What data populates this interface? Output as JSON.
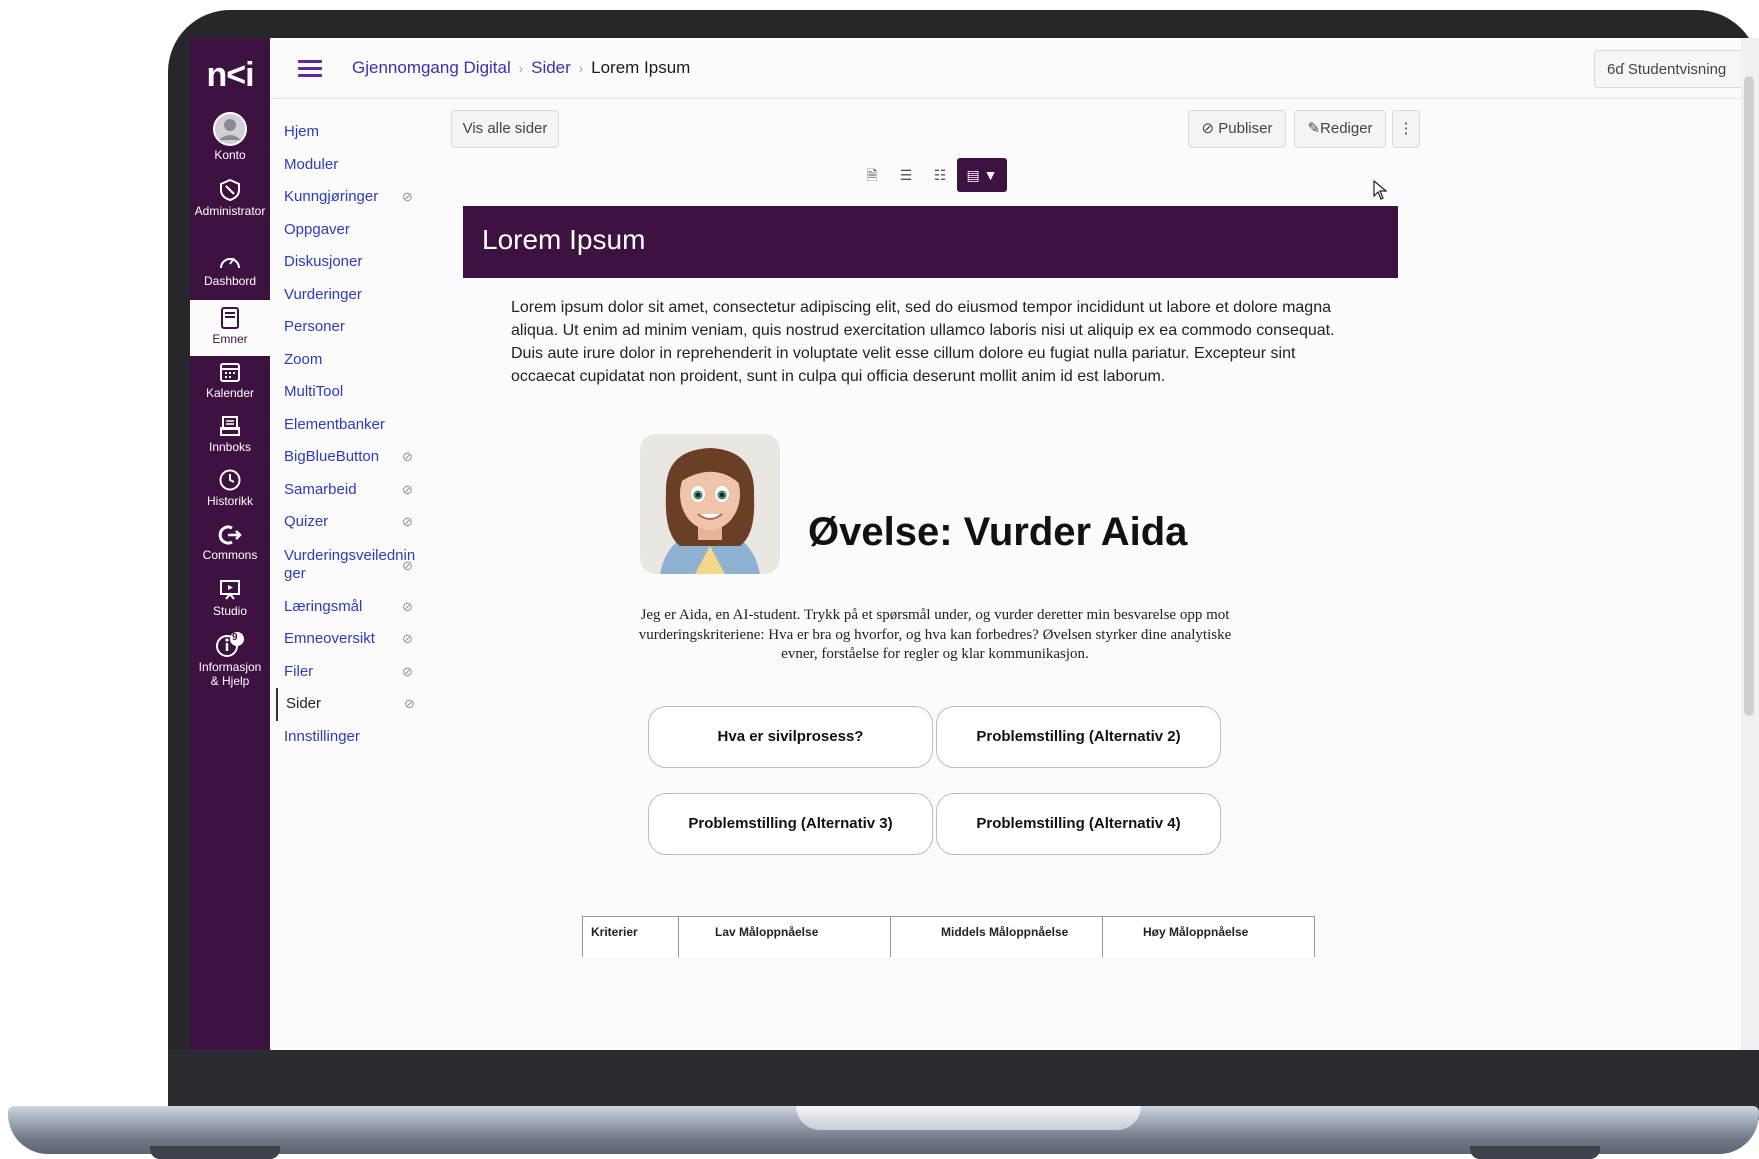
{
  "app": {
    "logo": "n<i"
  },
  "global_nav": {
    "items": [
      {
        "label": "Konto",
        "icon": "user-circle-icon"
      },
      {
        "label": "Administrator",
        "icon": "shield-icon"
      },
      {
        "label": "Dashbord",
        "icon": "gauge-icon"
      },
      {
        "label": "Emner",
        "icon": "book-icon"
      },
      {
        "label": "Kalender",
        "icon": "calendar-icon"
      },
      {
        "label": "Innboks",
        "icon": "inbox-icon"
      },
      {
        "label": "Historikk",
        "icon": "clock-icon"
      },
      {
        "label": "Commons",
        "icon": "commons-arrow-icon"
      },
      {
        "label": "Studio",
        "icon": "studio-icon"
      },
      {
        "label": "Informasjon & Hjelp",
        "icon": "info-icon",
        "badge": "9"
      }
    ]
  },
  "breadcrumb": {
    "course": "Gjennomgang Digital",
    "section": "Sider",
    "page": "Lorem Ipsum"
  },
  "header": {
    "student_view": "Studentvisning"
  },
  "course_nav": {
    "items": [
      {
        "label": "Hjem",
        "hidden": false
      },
      {
        "label": "Moduler",
        "hidden": false
      },
      {
        "label": "Kunngjøringer",
        "hidden": true
      },
      {
        "label": "Oppgaver",
        "hidden": false
      },
      {
        "label": "Diskusjoner",
        "hidden": false
      },
      {
        "label": "Vurderinger",
        "hidden": false
      },
      {
        "label": "Personer",
        "hidden": false
      },
      {
        "label": "Zoom",
        "hidden": false
      },
      {
        "label": "MultiTool",
        "hidden": false
      },
      {
        "label": "Elementbanker",
        "hidden": false
      },
      {
        "label": "BigBlueButton",
        "hidden": true
      },
      {
        "label": "Samarbeid",
        "hidden": true
      },
      {
        "label": "Quizer",
        "hidden": true
      },
      {
        "label": "Vurderingsveiledninger",
        "hidden": true
      },
      {
        "label": "Læringsmål",
        "hidden": true
      },
      {
        "label": "Emneoversikt",
        "hidden": true
      },
      {
        "label": "Filer",
        "hidden": true
      },
      {
        "label": "Sider",
        "hidden": true,
        "active": true
      },
      {
        "label": "Innstillinger",
        "hidden": false
      }
    ]
  },
  "actions": {
    "view_all": "Vis alle sider",
    "publish": "Publiser",
    "edit": "Rediger"
  },
  "page": {
    "title": "Lorem Ipsum",
    "body": "Lorem ipsum dolor sit amet, consectetur adipiscing elit, sed do eiusmod tempor incididunt ut labore et dolore magna aliqua. Ut enim ad minim veniam, quis nostrud exercitation ullamco laboris nisi ut aliquip ex ea commodo consequat. Duis aute irure dolor in reprehenderit in voluptate velit esse cillum dolore eu fugiat nulla pariatur. Excepteur sint occaecat cupidatat non proident, sunt in culpa qui officia deserunt mollit anim id est laborum.",
    "exercise_title": "Øvelse: Vurder Aida",
    "exercise_desc": "Jeg er Aida, en AI-student. Trykk på et spørsmål under, og vurder deretter min besvarelse opp mot vurderingskriteriene: Hva er bra og hvorfor, og hva  kan forbedres? Øvelsen styrker dine analytiske evner, forståelse for regler og klar kommunikasjon.",
    "options": [
      "Hva er sivilprosess?",
      "Problemstilling (Alternativ 2)",
      "Problemstilling (Alternativ 3)",
      "Problemstilling (Alternativ 4)"
    ],
    "table_headers": [
      "Kriterier",
      "Lav Måloppnåelse",
      "Middels Måloppnåelse",
      "Høy Måloppnåelse"
    ]
  },
  "colors": {
    "brand": "#3d1240",
    "link": "#2d3bbd"
  }
}
